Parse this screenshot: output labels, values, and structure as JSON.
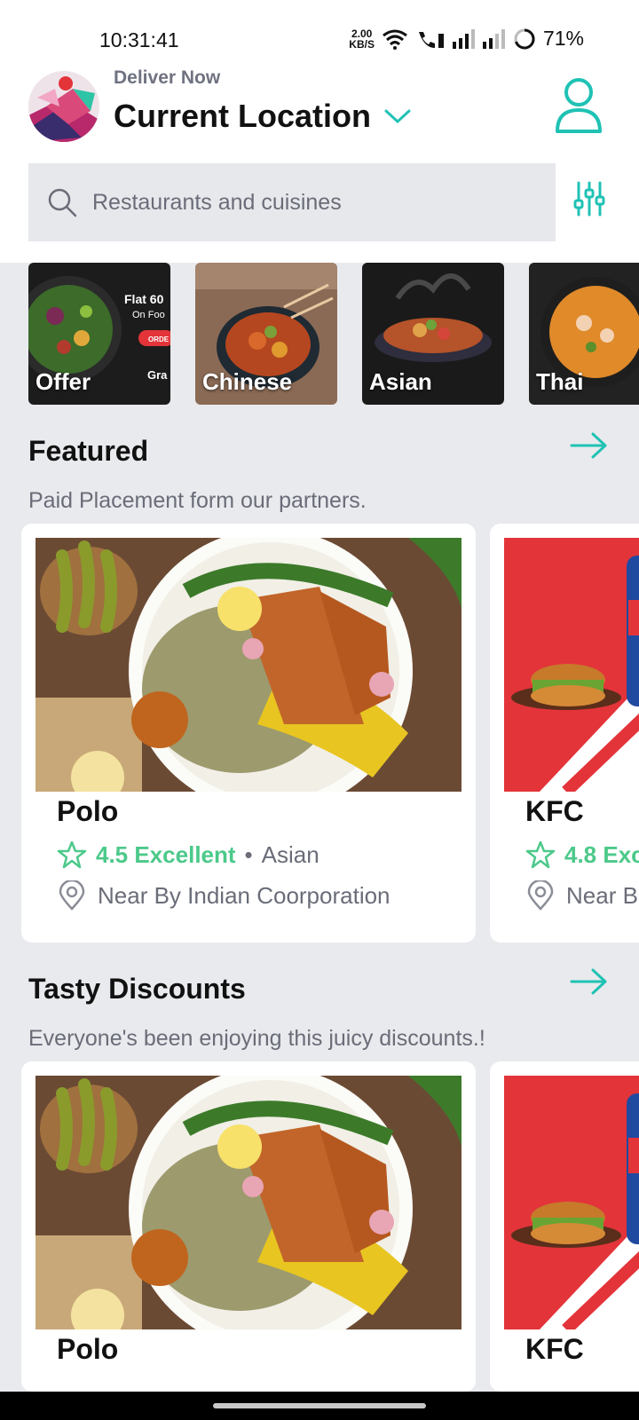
{
  "status_bar": {
    "time": "10:31:41",
    "net_speed_value": "2.00",
    "net_speed_unit": "KB/S",
    "battery": "71%"
  },
  "header": {
    "deliver_label": "Deliver Now",
    "location": "Current Location"
  },
  "search": {
    "placeholder": "Restaurants and cuisines"
  },
  "categories": [
    {
      "label": "Offer",
      "banner_title": "Flat 60",
      "banner_sub": "On Foo",
      "banner_btn": "ORDE",
      "banner_extra": "Gra"
    },
    {
      "label": "Chinese"
    },
    {
      "label": "Asian"
    },
    {
      "label": "Thai"
    }
  ],
  "featured": {
    "title": "Featured",
    "subtitle": "Paid Placement form our partners.",
    "cards": [
      {
        "name": "Polo",
        "rating": "4.5 Excellent",
        "separator": "•",
        "cuisine": "Asian",
        "location": "Near By Indian Coorporation"
      },
      {
        "name": "KFC",
        "rating": "4.8 Exc",
        "location": "Near B"
      }
    ]
  },
  "discounts": {
    "title": "Tasty Discounts",
    "subtitle": "Everyone's been enjoying this juicy discounts.!",
    "cards": [
      {
        "name": "Polo"
      },
      {
        "name": "KFC"
      }
    ]
  },
  "colors": {
    "accent": "#1fc2b4",
    "rating_green": "#4cc98a",
    "kfc_red": "#e3343a"
  }
}
